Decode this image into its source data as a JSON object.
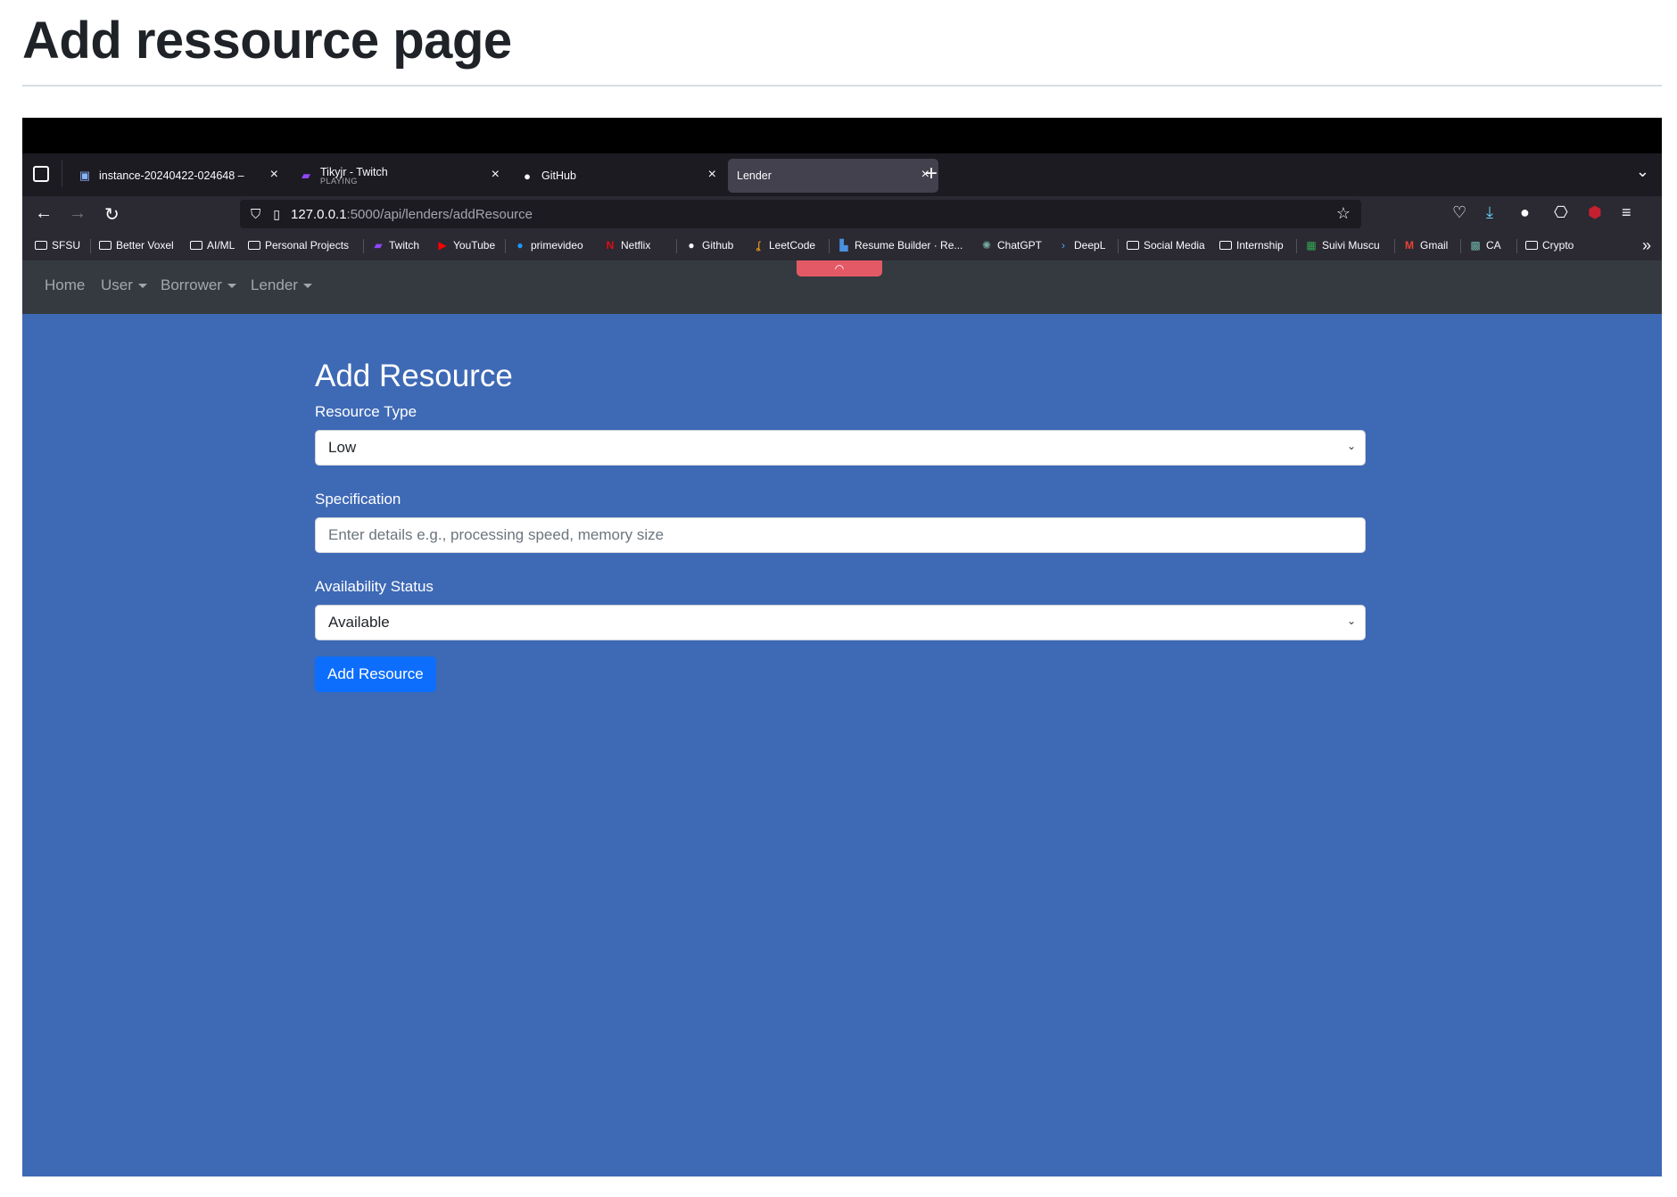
{
  "doc": {
    "title": "Add ressource page"
  },
  "browser": {
    "tabs": [
      {
        "label": "instance-20240422-024648 – ",
        "sub": ""
      },
      {
        "label": "Tikyjr - Twitch",
        "sub": "PLAYING"
      },
      {
        "label": "GitHub",
        "sub": ""
      },
      {
        "label": "Lender",
        "sub": ""
      }
    ],
    "url_host": "127.0.0.1",
    "url_path": ":5000/api/lenders/addResource",
    "bookmarks": [
      "SFSU",
      "Better Voxel",
      "AI/ML",
      "Personal Projects",
      "Twitch",
      "YouTube",
      "primevideo",
      "Netflix",
      "Github",
      "LeetCode",
      "Resume Builder · Re...",
      "ChatGPT",
      "DeepL",
      "Social Media",
      "Internship",
      "Suivi Muscu",
      "Gmail",
      "CA",
      "Crypto"
    ]
  },
  "site_nav": {
    "home": "Home",
    "user": "User",
    "borrower": "Borrower",
    "lender": "Lender"
  },
  "form": {
    "heading": "Add Resource",
    "resource_type_label": "Resource Type",
    "resource_type_value": "Low",
    "specification_label": "Specification",
    "specification_placeholder": "Enter details e.g., processing speed, memory size",
    "availability_label": "Availability Status",
    "availability_value": "Available",
    "submit_label": "Add Resource"
  },
  "colors": {
    "page_bg": "#3e69b5",
    "nav_bg": "#343a40",
    "primary": "#0d6efd",
    "pill": "#e35a66"
  }
}
